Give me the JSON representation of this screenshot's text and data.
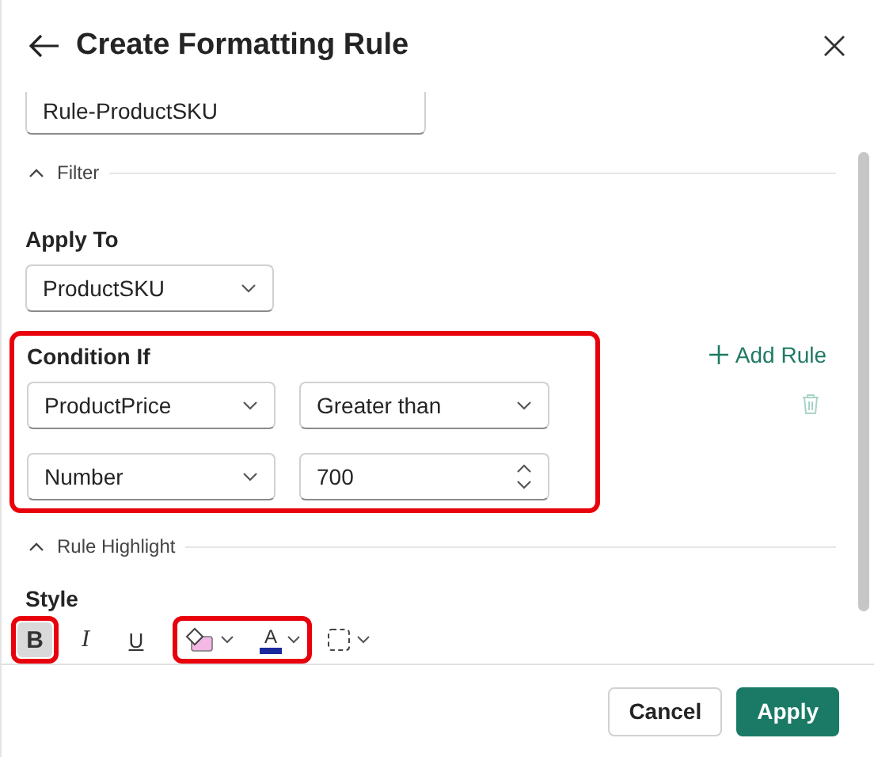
{
  "header": {
    "title": "Create Formatting Rule"
  },
  "rule_name": {
    "value": "Rule-ProductSKU"
  },
  "filter_section": {
    "label": "Filter",
    "expanded": true
  },
  "apply_to": {
    "label": "Apply To",
    "value": "ProductSKU"
  },
  "condition": {
    "label": "Condition If",
    "highlighted": true,
    "add_rule": "Add Rule",
    "rows": [
      {
        "kind": "dropdown",
        "value": "ProductPrice"
      },
      {
        "kind": "dropdown",
        "value": "Greater than"
      },
      {
        "kind": "dropdown",
        "value": "Number"
      },
      {
        "kind": "spin",
        "value": "700"
      }
    ]
  },
  "highlight_section": {
    "label": "Rule Highlight",
    "expanded": true
  },
  "style": {
    "label": "Style",
    "color_group_highlighted": true,
    "tools": [
      {
        "kind": "bold",
        "text": "B",
        "selected": true,
        "highlighted": true
      },
      {
        "kind": "italic",
        "text": "I",
        "selected": false,
        "highlighted": false
      },
      {
        "kind": "underline",
        "text": "U",
        "selected": false,
        "highlighted": false
      },
      {
        "kind": "fill",
        "color": "#f4b8e4"
      },
      {
        "kind": "font_color",
        "text": "A",
        "color": "#1a2a9c"
      },
      {
        "kind": "border",
        "highlighted": false
      }
    ]
  },
  "buttons": [
    {
      "kind": "secondary",
      "label": "Cancel"
    },
    {
      "kind": "primary",
      "label": "Apply"
    }
  ]
}
